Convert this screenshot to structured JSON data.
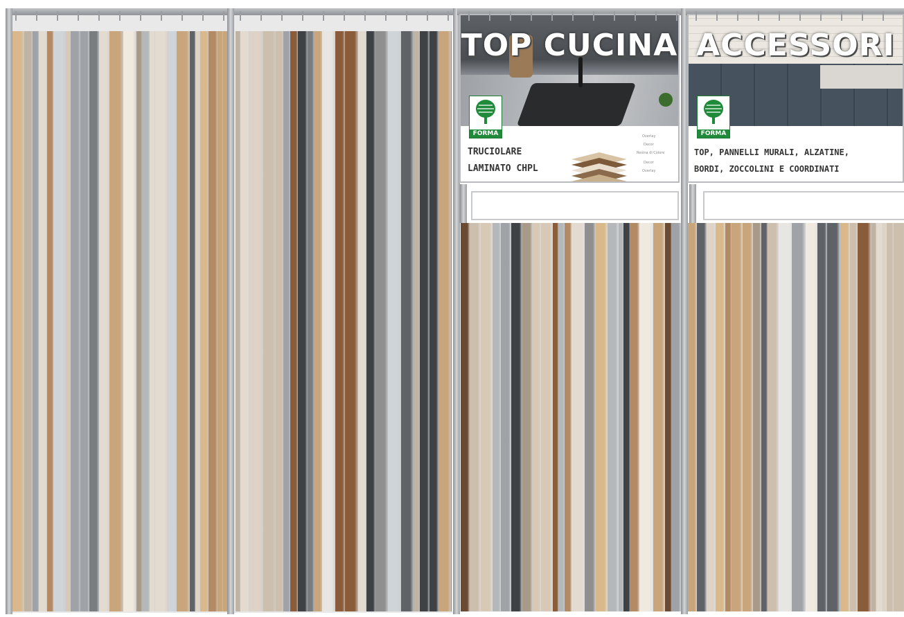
{
  "signs": [
    {
      "title": "TOP CUCINA",
      "logo_text": "FORMA",
      "lines": [
        "TRUCIOLARE",
        "LAMINATO CHPL"
      ],
      "layer_labels": [
        "Overlay",
        "Decor",
        "Resina di Colore",
        "Decor",
        "Overlay"
      ]
    },
    {
      "title": "ACCESSORI",
      "logo_text": "FORMA",
      "lines": [
        "TOP, PANNELLI MURALI, ALZATINE,",
        "BORDI, ZOCCOLINI E COORDINATI"
      ]
    }
  ],
  "colors": {
    "frame": "#9a9da1",
    "forma_green": "#1f8a3a",
    "sign_bg": "#ffffff"
  },
  "icons": [
    "forma-tree-logo"
  ]
}
